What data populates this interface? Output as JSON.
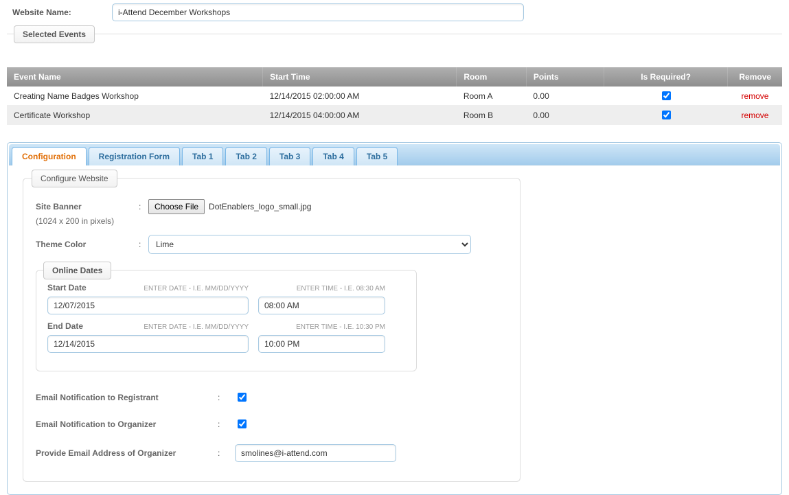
{
  "websiteNameLabel": "Website Name:",
  "websiteName": "i-Attend December Workshops",
  "selectedEventsLegend": "Selected Events",
  "eventTable": {
    "headers": {
      "name": "Event Name",
      "start": "Start Time",
      "room": "Room",
      "points": "Points",
      "required": "Is Required?",
      "remove": "Remove"
    },
    "rows": [
      {
        "name": "Creating Name Badges Workshop",
        "start": "12/14/2015 02:00:00 AM",
        "room": "Room A",
        "points": "0.00",
        "required": true,
        "removeText": "remove"
      },
      {
        "name": "Certificate Workshop",
        "start": "12/14/2015 04:00:00 AM",
        "room": "Room B",
        "points": "0.00",
        "required": true,
        "removeText": "remove"
      }
    ]
  },
  "tabs": [
    "Configuration",
    "Registration Form",
    "Tab 1",
    "Tab 2",
    "Tab 3",
    "Tab 4",
    "Tab 5"
  ],
  "activeTabIndex": 0,
  "configure": {
    "legend": "Configure Website",
    "siteBannerLabel": "Site Banner",
    "siteBannerHint": "(1024 x 200 in pixels)",
    "chooseFileBtn": "Choose File",
    "siteBannerFile": "DotEnablers_logo_small.jpg",
    "themeColorLabel": "Theme Color",
    "themeColorValue": "Lime",
    "onlineDatesLegend": "Online Dates",
    "startDateLabel": "Start Date",
    "startDateHint": "ENTER DATE - I.E. MM/DD/YYYY",
    "startDateValue": "12/07/2015",
    "startTimeHint": "ENTER TIME - I.E. 08:30 AM",
    "startTimeValue": "08:00 AM",
    "endDateLabel": "End Date",
    "endDateHint": "ENTER DATE - I.E. MM/DD/YYYY",
    "endDateValue": "12/14/2015",
    "endTimeHint": "ENTER TIME - I.E. 10:30 PM",
    "endTimeValue": "10:00 PM",
    "emailRegistrantLabel": "Email Notification to Registrant",
    "emailRegistrantChecked": true,
    "emailOrganizerLabel": "Email Notification to Organizer",
    "emailOrganizerChecked": true,
    "organizerEmailLabel": "Provide Email Address of Organizer",
    "organizerEmailValue": "smolines@i-attend.com"
  }
}
